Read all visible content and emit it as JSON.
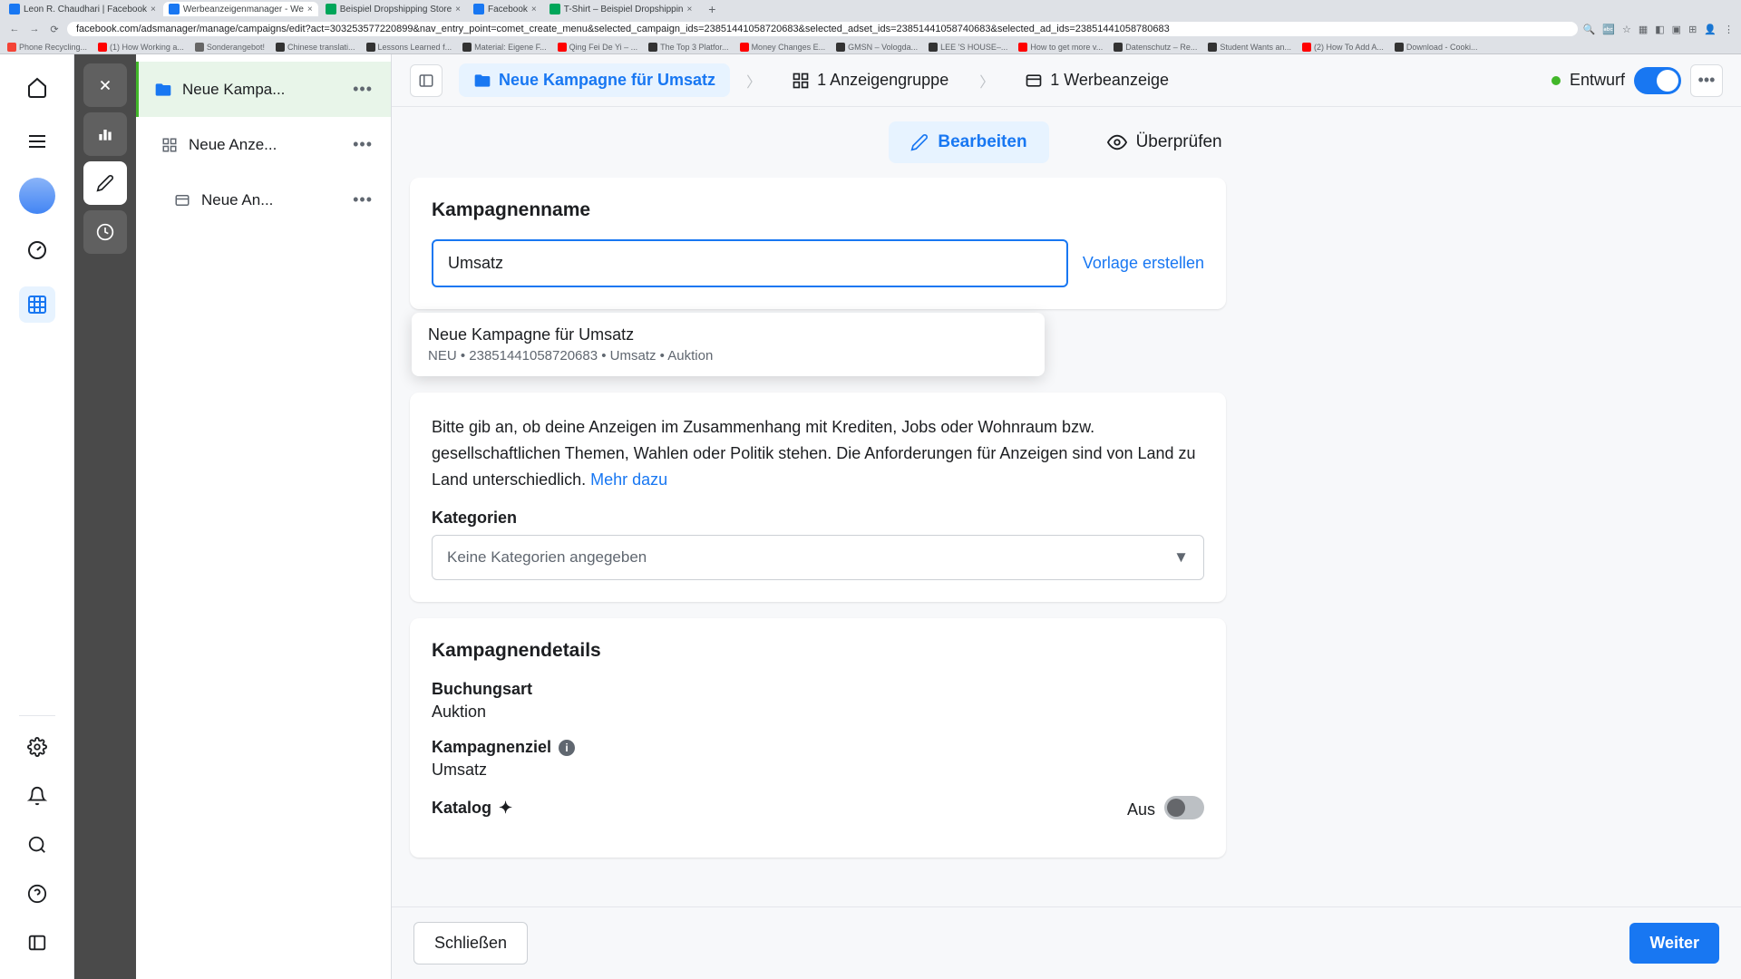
{
  "browser": {
    "tabs": [
      {
        "label": "Leon R. Chaudhari | Facebook"
      },
      {
        "label": "Werbeanzeigenmanager - We"
      },
      {
        "label": "Beispiel Dropshipping Store"
      },
      {
        "label": "Facebook"
      },
      {
        "label": "T-Shirt – Beispiel Dropshippin"
      }
    ],
    "url": "facebook.com/adsmanager/manage/campaigns/edit?act=303253577220899&nav_entry_point=comet_create_menu&selected_campaign_ids=23851441058720683&selected_adset_ids=23851441058740683&selected_ad_ids=23851441058780683",
    "bookmarks": [
      "Phone Recycling...",
      "(1) How Working a...",
      "Sonderangebot!",
      "Chinese translati...",
      "Lessons Learned f...",
      "Material: Eigene F...",
      "Qing Fei De Yi – ...",
      "The Top 3 Platfor...",
      "Money Changes E...",
      "GMSN – Vologda...",
      "Datenschutz – Re...",
      "Student Wants an...",
      "(2) How To Add A...",
      "Download - Cooki...",
      "LEE 'S HOUSE–...",
      "How to get more v..."
    ]
  },
  "tree": {
    "campaign": "Neue Kampa...",
    "adset": "Neue Anze...",
    "ad": "Neue An..."
  },
  "breadcrumb": {
    "campaign": "Neue Kampagne für Umsatz",
    "adset": "1 Anzeigengruppe",
    "ad": "1 Werbeanzeige",
    "status": "Entwurf"
  },
  "tabs": {
    "edit": "Bearbeiten",
    "review": "Überprüfen"
  },
  "nameCard": {
    "title": "Kampagnenname",
    "value": "Umsatz",
    "template": "Vorlage erstellen"
  },
  "autocomplete": {
    "title": "Neue Kampagne für Umsatz",
    "sub": "NEU • 23851441058720683 • Umsatz • Auktion"
  },
  "category": {
    "desc": "Bitte gib an, ob deine Anzeigen im Zusammenhang mit Krediten, Jobs oder Wohnraum bzw. gesellschaftlichen Themen, Wahlen oder Politik stehen. Die Anforderungen für Anzeigen sind von Land zu Land unterschiedlich. ",
    "more": "Mehr dazu",
    "label": "Kategorien",
    "placeholder": "Keine Kategorien angegeben"
  },
  "details": {
    "title": "Kampagnendetails",
    "bookingLabel": "Buchungsart",
    "bookingVal": "Auktion",
    "goalLabel": "Kampagnenziel",
    "goalVal": "Umsatz",
    "catalogLabel": "Katalog",
    "catalogVal": "Aus"
  },
  "footer": {
    "close": "Schließen",
    "next": "Weiter"
  }
}
